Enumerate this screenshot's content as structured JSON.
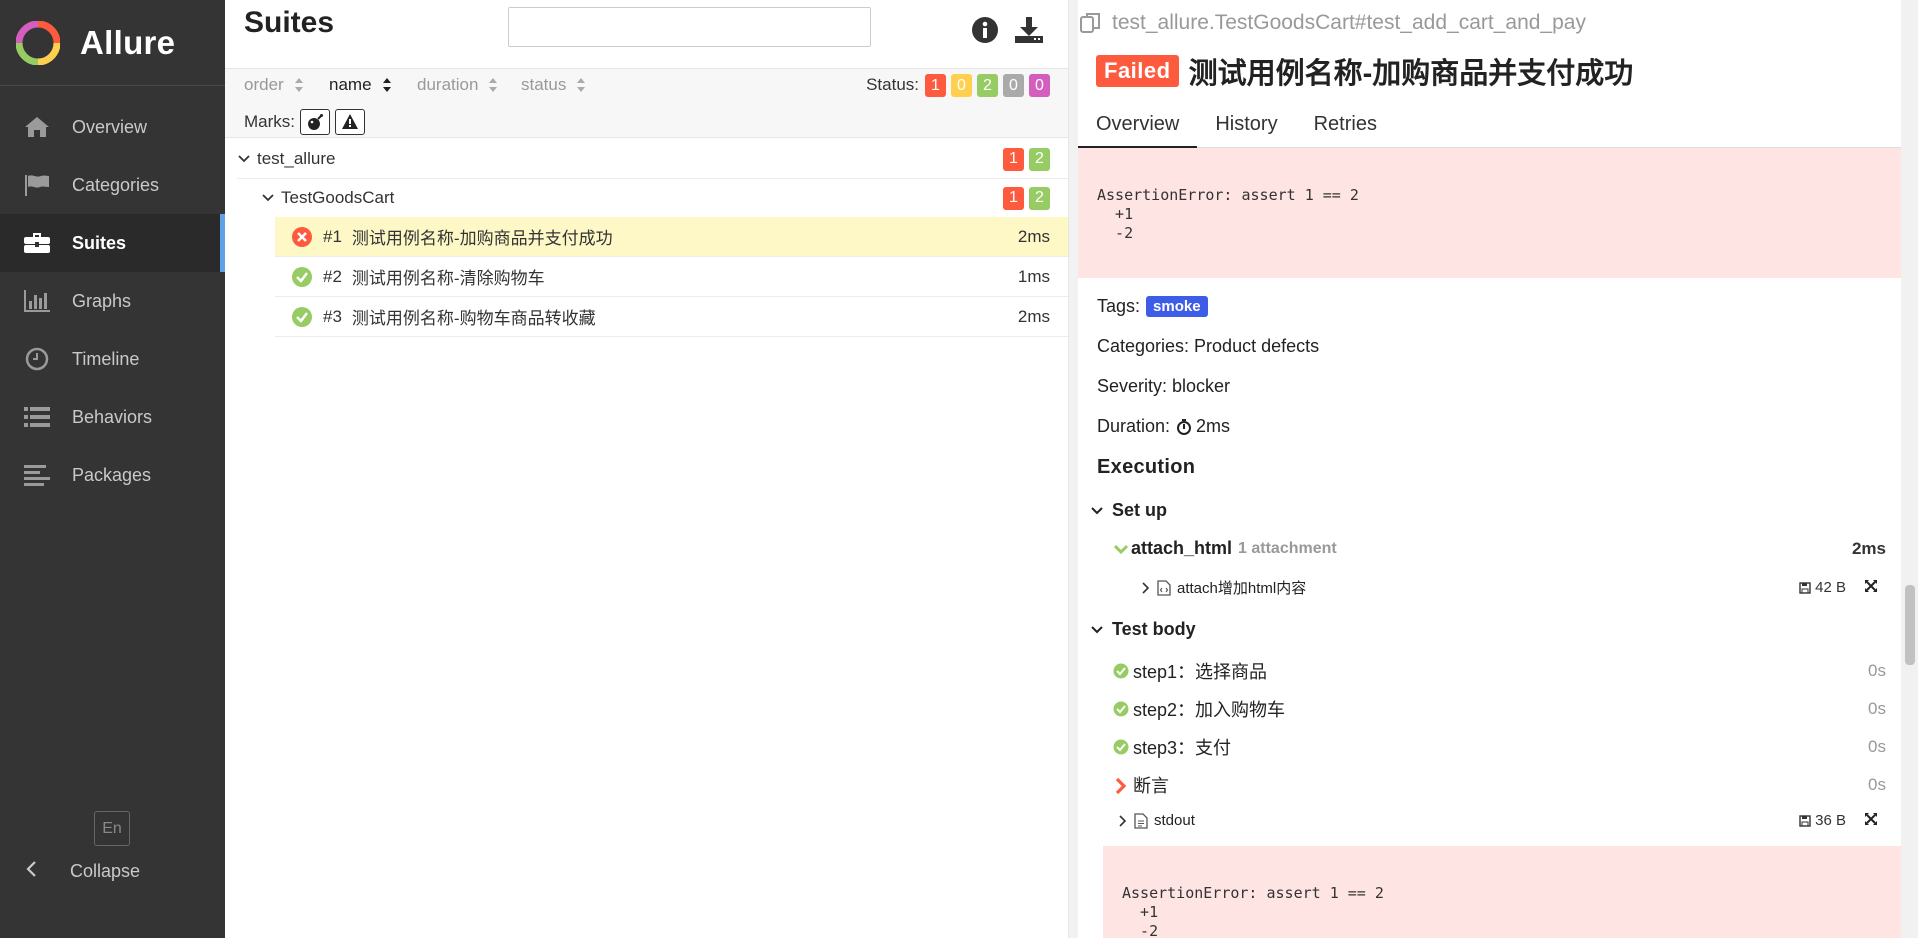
{
  "app": {
    "name": "Allure"
  },
  "nav": {
    "items": [
      {
        "label": "Overview",
        "icon": "home-icon"
      },
      {
        "label": "Categories",
        "icon": "flag-icon"
      },
      {
        "label": "Suites",
        "icon": "briefcase-icon"
      },
      {
        "label": "Graphs",
        "icon": "bar-chart-icon"
      },
      {
        "label": "Timeline",
        "icon": "clock-icon"
      },
      {
        "label": "Behaviors",
        "icon": "list-icon"
      },
      {
        "label": "Packages",
        "icon": "align-left-icon"
      }
    ],
    "active": "Suites",
    "lang": "En",
    "collapse": "Collapse"
  },
  "suites": {
    "title": "Suites",
    "search_placeholder": "",
    "sort": {
      "order": "order",
      "name": "name",
      "duration": "duration",
      "status": "status"
    },
    "status_label": "Status:",
    "status_counts": [
      "1",
      "0",
      "2",
      "0",
      "0"
    ],
    "marks_label": "Marks:",
    "tree": {
      "root": {
        "name": "test_allure",
        "failed": "1",
        "passed": "2"
      },
      "child": {
        "name": "TestGoodsCart",
        "failed": "1",
        "passed": "2"
      },
      "cases": [
        {
          "num": "#1",
          "name": "测试用例名称-加购商品并支付成功",
          "duration": "2ms",
          "status": "failed"
        },
        {
          "num": "#2",
          "name": "测试用例名称-清除购物车",
          "duration": "1ms",
          "status": "passed"
        },
        {
          "num": "#3",
          "name": "测试用例名称-购物车商品转收藏",
          "duration": "2ms",
          "status": "passed"
        }
      ]
    }
  },
  "detail": {
    "fullname": "test_allure.TestGoodsCart#test_add_cart_and_pay",
    "status_badge": "Failed",
    "title": "测试用例名称-加购商品并支付成功",
    "tabs": [
      "Overview",
      "History",
      "Retries"
    ],
    "error": "AssertionError: assert 1 == 2\n  +1\n  -2",
    "tags_label": "Tags:",
    "tag": "smoke",
    "categories": "Categories: Product defects",
    "severity": "Severity: blocker",
    "duration_label": "Duration:",
    "duration": "2ms",
    "execution": "Execution",
    "setup": {
      "label": "Set up",
      "fixture": "attach_html",
      "fixture_meta": "1 attachment",
      "fixture_duration": "2ms",
      "attachment": "attach增加html内容",
      "attachment_size": "42 B"
    },
    "body": {
      "label": "Test body",
      "steps": [
        {
          "name": "step1：选择商品",
          "duration": "0s",
          "status": "passed"
        },
        {
          "name": "step2：加入购物车",
          "duration": "0s",
          "status": "passed"
        },
        {
          "name": "step3：支付",
          "duration": "0s",
          "status": "passed"
        },
        {
          "name": "断言",
          "duration": "0s",
          "status": "failed"
        }
      ],
      "stdout": "stdout",
      "stdout_size": "36 B",
      "error": "AssertionError: assert 1 == 2\n  +1\n  -2"
    }
  },
  "colors": {
    "failed": "#fd5a3e",
    "passed": "#97cc64",
    "broken": "#ffd050",
    "skipped": "#aaaaaa",
    "unknown": "#d35ebe",
    "tag": "#3d5de8"
  }
}
